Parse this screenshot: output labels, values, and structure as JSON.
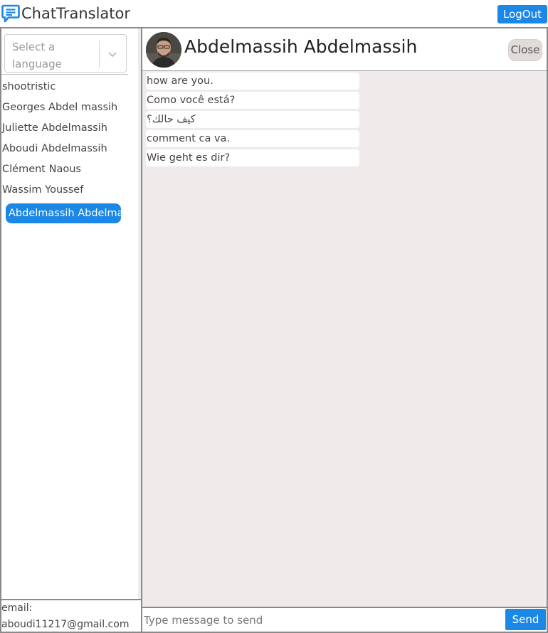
{
  "app": {
    "title": "ChatTranslator",
    "logout_label": "LogOut",
    "brand_icon": "chat-bubble-icon",
    "accent_color": "#1b87e6"
  },
  "sidebar": {
    "language_select": {
      "placeholder": "Select a language",
      "icon": "chevron-down-icon"
    },
    "contacts": [
      "shootristic",
      "Georges Abdel massih",
      "Juliette Abdelmassih",
      "Aboudi Abdelmassih",
      "Clément Naous",
      "Wassim Youssef"
    ],
    "active_contact": "Abdelmassih Abdelmassih",
    "email_label": "email:",
    "email_value": "aboudi11217@gmail.com"
  },
  "chat": {
    "contact_name": "Abdelmassih Abdelmassih",
    "close_label": "Close",
    "background_color": "#f0eaea",
    "messages": [
      "how are you.",
      "Como você está?",
      "كيف حالك؟",
      "comment ca va.",
      "Wie geht es dir?"
    ],
    "input_placeholder": "Type message to send",
    "send_label": "Send"
  }
}
